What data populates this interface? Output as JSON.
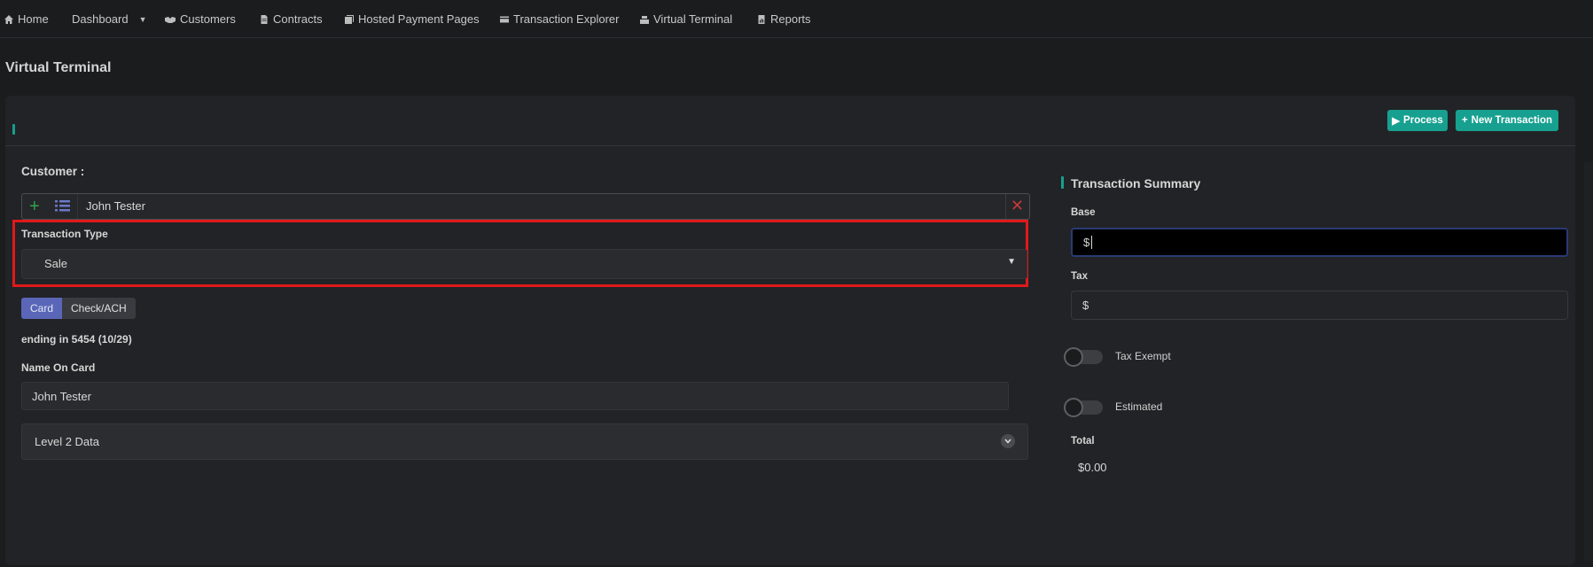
{
  "nav": {
    "home": "Home",
    "dashboard": "Dashboard",
    "customers": "Customers",
    "contracts": "Contracts",
    "hosted_payment_pages": "Hosted Payment Pages",
    "transaction_explorer": "Transaction Explorer",
    "virtual_terminal": "Virtual Terminal",
    "reports": "Reports"
  },
  "page": {
    "title": "Virtual Terminal"
  },
  "actions": {
    "process": "Process",
    "new_transaction": "New Transaction"
  },
  "customer": {
    "label": "Customer :",
    "selected": "John Tester"
  },
  "transaction_type": {
    "label": "Transaction Type",
    "selected": "Sale"
  },
  "payment_tabs": {
    "card": "Card",
    "check": "Check/ACH",
    "active": "Card"
  },
  "card": {
    "ending": "ending in 5454 (10/29)",
    "name_label": "Name On Card",
    "name_value": "John Tester"
  },
  "level2": {
    "label": "Level 2 Data"
  },
  "summary": {
    "title": "Transaction Summary",
    "base_label": "Base",
    "base_prefix": "$",
    "tax_label": "Tax",
    "tax_prefix": "$",
    "tax_exempt_label": "Tax Exempt",
    "tax_exempt_on": false,
    "estimated_label": "Estimated",
    "estimated_on": false,
    "total_label": "Total",
    "total_value": "$0.00"
  },
  "colors": {
    "accent": "#17a090",
    "active_tab": "#5a67b8",
    "highlight": "#e0191b",
    "add": "#2fa34a",
    "clear": "#c43a3a"
  }
}
